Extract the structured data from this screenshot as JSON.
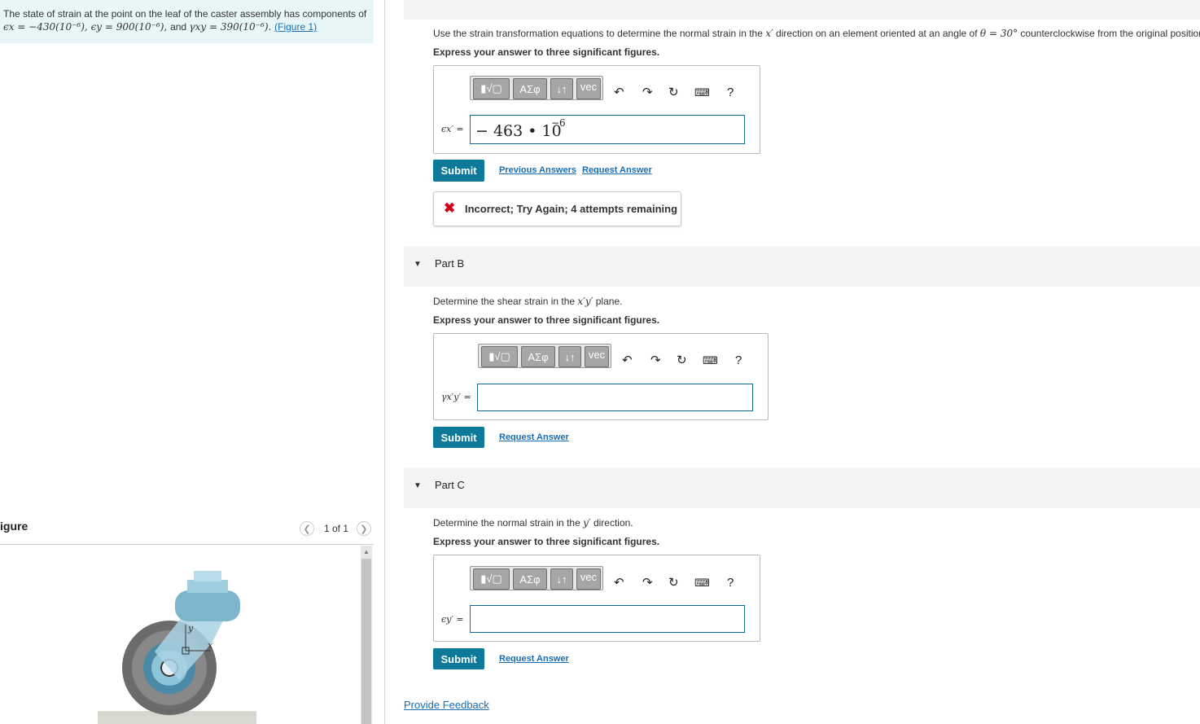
{
  "problem": {
    "lead": "The state of strain at the point on the leaf of the caster assembly has components of",
    "eps_x_sym": "ϵx",
    "eps_x_val": " = −430(10⁻⁶), ",
    "eps_y_sym": "ϵy",
    "eps_y_val": " = 900(10⁻⁶), ",
    "and_word": "and ",
    "gamma_sym": "γxy",
    "gamma_val": " = 390(10⁻⁶). ",
    "figure_link": "(Figure 1)"
  },
  "figure": {
    "title": "igure",
    "prev_icon": "chevron-left-icon",
    "next_icon": "chevron-right-icon",
    "counter": "1 of 1",
    "labels": {
      "y": "y",
      "x": "x"
    }
  },
  "part_a": {
    "question_pre": "Use the strain transformation equations to determine the normal strain in the ",
    "question_var": "x′",
    "question_mid": " direction on an element oriented at an angle of ",
    "question_angle": "θ = 30°",
    "question_post": " counterclockwise from the original position.",
    "instruction": "Express your answer to three significant figures.",
    "label": "ϵx′ =",
    "answer_value": "− 463 • 10",
    "answer_exp": "−6",
    "submit": "Submit",
    "prev_answers": "Previous Answers",
    "request_answer": "Request Answer",
    "feedback": "Incorrect; Try Again; 4 attempts remaining"
  },
  "part_b": {
    "title": "Part B",
    "question_pre": "Determine the shear strain in the ",
    "question_var": "x′y′",
    "question_post": " plane.",
    "instruction": "Express your answer to three significant figures.",
    "label": "γx′y′ =",
    "submit": "Submit",
    "request_answer": "Request Answer"
  },
  "part_c": {
    "title": "Part C",
    "question_pre": "Determine the normal strain in the ",
    "question_var": "y′",
    "question_post": " direction.",
    "instruction": "Express your answer to three significant figures.",
    "label": "ϵy′ =",
    "submit": "Submit",
    "request_answer": "Request Answer"
  },
  "toolbar": {
    "template_label": "▮√▢",
    "greek_label": "ΑΣφ",
    "arrows_label": "↓↑",
    "vec_label": "vec",
    "help_label": "?"
  },
  "provide_feedback": "Provide Feedback",
  "colors": {
    "submit": "#0e7a9a",
    "link": "#1a6db0",
    "problem_bg": "#e8f6f7",
    "error": "#d0021b"
  }
}
